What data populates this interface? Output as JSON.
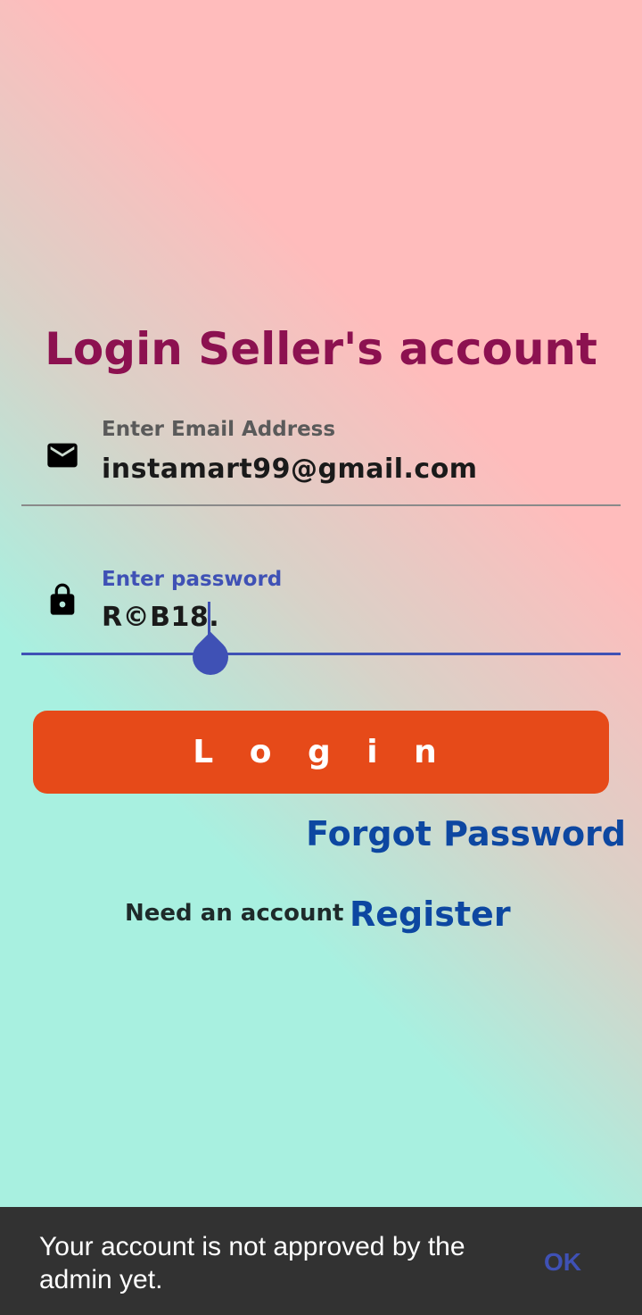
{
  "title": "Login Seller's account",
  "email": {
    "label": "Enter Email Address",
    "value": "instamart99@gmail.com",
    "icon": "mail-icon"
  },
  "password": {
    "label": "Enter password",
    "value": "R©B18.",
    "icon": "lock-icon"
  },
  "login_button": "L o g i n",
  "forgot_link": "Forgot Password",
  "need_account": "Need an account",
  "register_link": "Register",
  "snackbar": {
    "message": "Your account is not approved by the admin yet.",
    "action": "OK"
  },
  "colors": {
    "title": "#8c1150",
    "accent": "#3f51b5",
    "button": "#e64a19",
    "link": "#0d47a1",
    "snackbar": "#323232"
  }
}
